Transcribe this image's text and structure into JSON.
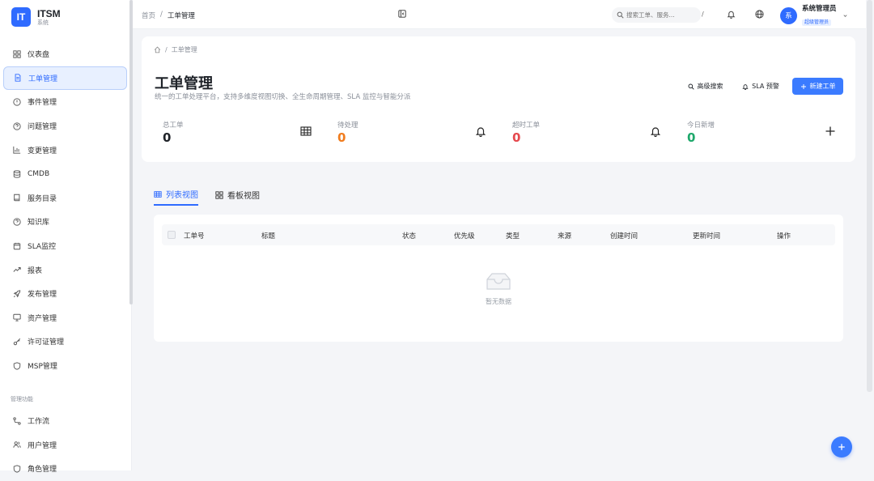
{
  "app": {
    "logo_mark": "IT",
    "title": "ITSM",
    "subtitle": "系统"
  },
  "sidebar": {
    "items": [
      {
        "label": "仪表盘",
        "icon": "dashboard-icon"
      },
      {
        "label": "工单管理",
        "icon": "document-icon",
        "active": true
      },
      {
        "label": "事件管理",
        "icon": "alert-circle-icon"
      },
      {
        "label": "问题管理",
        "icon": "question-circle-icon"
      },
      {
        "label": "变更管理",
        "icon": "bar-chart-icon"
      },
      {
        "label": "CMDB",
        "icon": "database-icon"
      },
      {
        "label": "服务目录",
        "icon": "book-icon"
      },
      {
        "label": "知识库",
        "icon": "question-circle-icon"
      },
      {
        "label": "SLA监控",
        "icon": "calendar-icon"
      },
      {
        "label": "报表",
        "icon": "trend-icon"
      },
      {
        "label": "发布管理",
        "icon": "rocket-icon"
      },
      {
        "label": "资产管理",
        "icon": "monitor-icon"
      },
      {
        "label": "许可证管理",
        "icon": "key-icon"
      },
      {
        "label": "MSP管理",
        "icon": "shield-icon"
      }
    ],
    "section_label": "管理功能",
    "admin_items": [
      {
        "label": "工作流",
        "icon": "workflow-icon"
      },
      {
        "label": "用户管理",
        "icon": "users-icon"
      },
      {
        "label": "角色管理",
        "icon": "shield-icon"
      }
    ]
  },
  "topbar": {
    "breadcrumb": [
      "首页",
      "/",
      "工单管理"
    ],
    "search_placeholder": "搜索工单、服务...",
    "search_shortcut": "/",
    "user": {
      "avatar": "系",
      "name": "系统管理员",
      "role": "超级管理员"
    }
  },
  "page": {
    "breadcrumb": [
      "/",
      "工单管理"
    ],
    "title": "工单管理",
    "description": "统一的工单处理平台，支持多维度视图切换、全生命周期管理、SLA 监控与智能分派",
    "buttons": {
      "advanced_search": "高级搜索",
      "sla_alert": "SLA 预警",
      "new_ticket": "新建工单"
    },
    "stats": [
      {
        "label": "总工单",
        "value": "0",
        "color": "#1f2329",
        "icon": "table-icon"
      },
      {
        "label": "待处理",
        "value": "0",
        "color": "#f07c1e",
        "icon": "bell-icon"
      },
      {
        "label": "超时工单",
        "value": "0",
        "color": "#e5484d",
        "icon": "bell-icon"
      },
      {
        "label": "今日新增",
        "value": "0",
        "color": "#1ea86b",
        "icon": "plus-icon"
      }
    ],
    "tabs": [
      {
        "label": "列表视图",
        "active": true
      },
      {
        "label": "看板视图",
        "active": false
      }
    ],
    "table": {
      "columns": [
        "工单号",
        "标题",
        "状态",
        "优先级",
        "类型",
        "来源",
        "创建时间",
        "更新时间",
        "操作"
      ],
      "empty_text": "暂无数据"
    }
  },
  "colors": {
    "primary": "#2f6bff"
  }
}
